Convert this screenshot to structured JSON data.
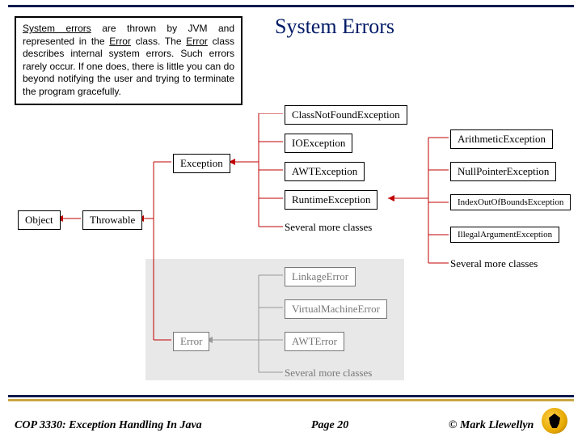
{
  "title": "System Errors",
  "textbox": {
    "t1": "System errors",
    "t2": " are thrown by JVM and represented in the ",
    "t3": "Error",
    "t4": " class. The ",
    "t5": "Error",
    "t6": " class describes internal system errors. Such errors rarely occur. If one does, there is little you can do beyond notifying the user and trying to terminate the program gracefully."
  },
  "nodes": {
    "object": "Object",
    "throwable": "Throwable",
    "exception": "Exception",
    "error": "Error",
    "classnotfound": "ClassNotFoundException",
    "ioexception": "IOException",
    "awtexception": "AWTException",
    "runtimeexception": "RuntimeException",
    "linkageerror": "LinkageError",
    "vmerror": "VirtualMachineError",
    "awterror": "AWTError",
    "arithmetic": "ArithmeticException",
    "nullpointer": "NullPointerException",
    "indexoob": "IndexOutOfBoundsException",
    "illegalarg": "IllegalArgumentException"
  },
  "labels": {
    "more1": "Several more classes",
    "more2": "Several more classes",
    "more3": "Several more classes"
  },
  "footer": {
    "course": "COP 3330:  Exception Handling In Java",
    "page": "Page 20",
    "copy": "© Mark Llewellyn"
  },
  "chart_data": {
    "type": "tree",
    "title": "System Errors",
    "highlighted_subtree": "Error",
    "edges": [
      [
        "Object",
        "Throwable"
      ],
      [
        "Throwable",
        "Exception"
      ],
      [
        "Throwable",
        "Error"
      ],
      [
        "Exception",
        "ClassNotFoundException"
      ],
      [
        "Exception",
        "IOException"
      ],
      [
        "Exception",
        "AWTException"
      ],
      [
        "Exception",
        "RuntimeException"
      ],
      [
        "Exception",
        "Several more classes"
      ],
      [
        "RuntimeException",
        "ArithmeticException"
      ],
      [
        "RuntimeException",
        "NullPointerException"
      ],
      [
        "RuntimeException",
        "IndexOutOfBoundsException"
      ],
      [
        "RuntimeException",
        "IllegalArgumentException"
      ],
      [
        "RuntimeException",
        "Several more classes"
      ],
      [
        "Error",
        "LinkageError"
      ],
      [
        "Error",
        "VirtualMachineError"
      ],
      [
        "Error",
        "AWTError"
      ],
      [
        "Error",
        "Several more classes"
      ]
    ]
  }
}
